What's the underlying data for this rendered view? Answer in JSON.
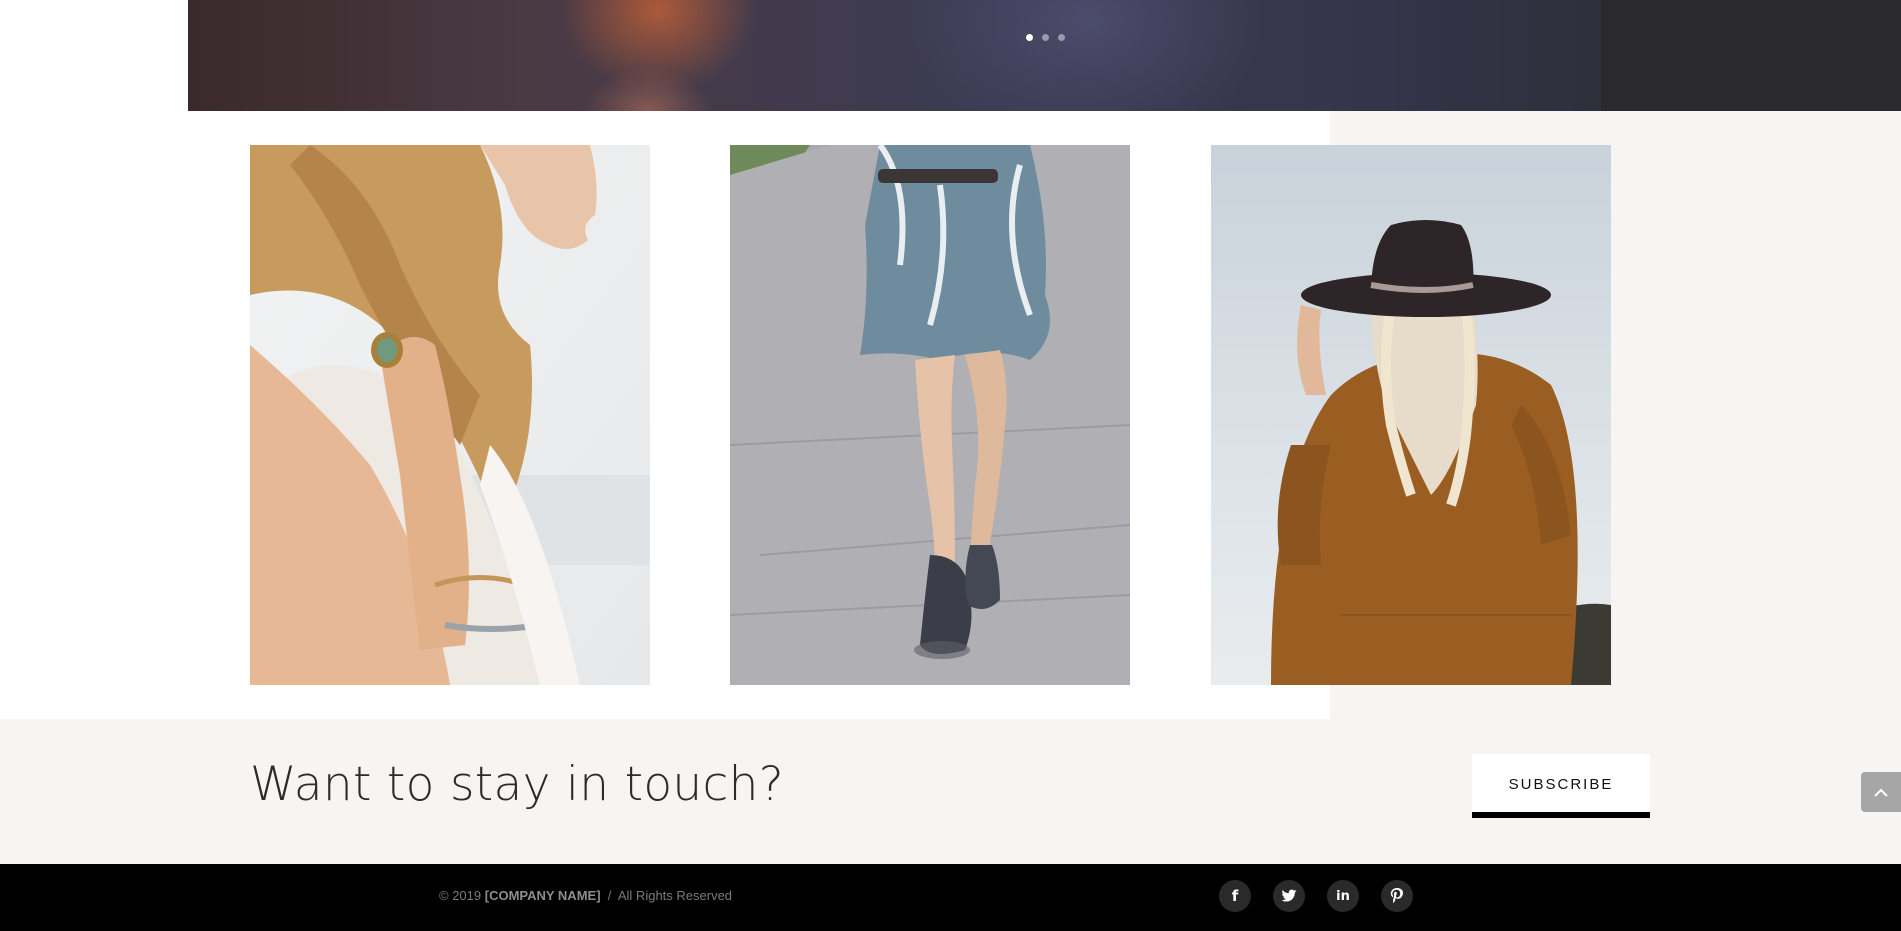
{
  "slider": {
    "dots": [
      {
        "active": true
      },
      {
        "active": false
      },
      {
        "active": false
      }
    ]
  },
  "gallery": {
    "images": [
      {
        "icon": "woman-with-ring-photo"
      },
      {
        "icon": "dress-and-boots-photo"
      },
      {
        "icon": "woman-in-hat-photo"
      }
    ]
  },
  "newsletter": {
    "headline": "Want to stay in touch?",
    "button_label": "SUBSCRIBE"
  },
  "back_to_top": {
    "icon": "chevron-up-icon"
  },
  "footer": {
    "copyright_prefix": "© 2019 ",
    "company": "[COMPANY NAME]",
    "copyright_suffix": "  /  All Rights Reserved",
    "social": [
      {
        "icon": "facebook-icon",
        "glyph": "f"
      },
      {
        "icon": "twitter-icon",
        "glyph": "🐦"
      },
      {
        "icon": "linkedin-icon",
        "glyph": "in"
      },
      {
        "icon": "pinterest-icon",
        "glyph": "P"
      }
    ]
  },
  "colors": {
    "accent": "#000000",
    "background_beige": "#f6f5f3",
    "footer_bg": "#000000"
  }
}
